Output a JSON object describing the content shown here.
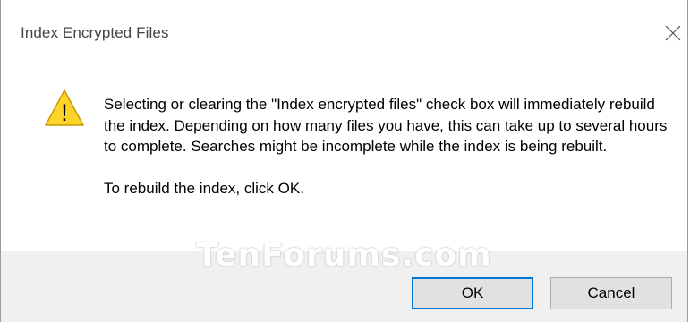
{
  "dialog": {
    "title": "Index Encrypted Files",
    "close_icon": "close-icon",
    "warning_icon": "warning-icon",
    "warning_icon_glyph": "!",
    "message": "Selecting or clearing the \"Index encrypted files\" check box will immediately rebuild the index. Depending on how many files you have, this can take up to several hours to complete. Searches might be incomplete while the index is being rebuilt.",
    "instruction": "To rebuild the index, click OK.",
    "watermark": "TenForums.com",
    "buttons": {
      "ok_label": "OK",
      "cancel_label": "Cancel"
    }
  },
  "colors": {
    "accent": "#0078d7",
    "footer_bg": "#f0f0f0",
    "warning_fill": "#ffd42a"
  }
}
